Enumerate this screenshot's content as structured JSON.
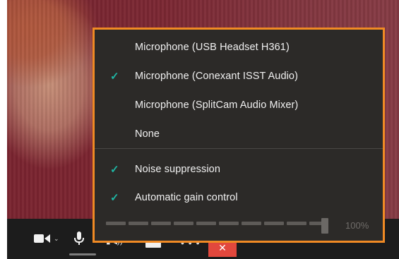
{
  "devices": [
    {
      "label": "Microphone (USB Headset H361)",
      "selected": false
    },
    {
      "label": "Microphone (Conexant ISST Audio)",
      "selected": true
    },
    {
      "label": "Microphone (SplitCam Audio Mixer)",
      "selected": false
    },
    {
      "label": "None",
      "selected": false
    }
  ],
  "options": [
    {
      "label": "Noise suppression",
      "checked": true
    },
    {
      "label": "Automatic gain control",
      "checked": true
    }
  ],
  "volume": {
    "value": 1.0,
    "label": "100%"
  },
  "icons": {
    "check": "✓",
    "camera": "camera-icon",
    "microphone": "microphone-icon",
    "speaker": "speaker-icon",
    "share": "screen-share-icon",
    "more": "more-icon",
    "hangup": "hangup-icon"
  },
  "colors": {
    "accent": "#1fb6a4",
    "highlight_border": "#f08a24",
    "hangup": "#e2483d"
  }
}
